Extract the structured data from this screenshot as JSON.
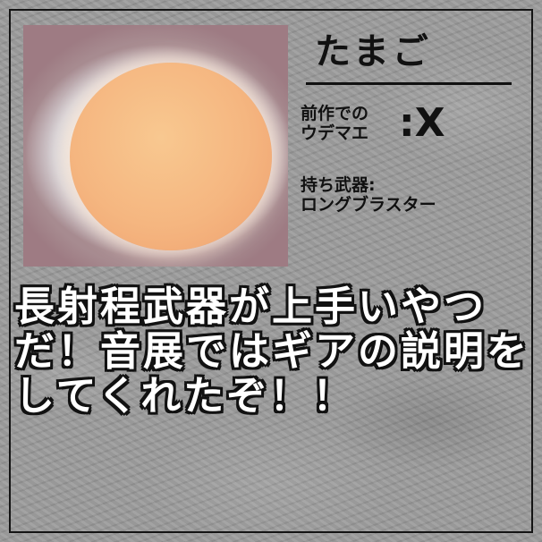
{
  "profile": {
    "name": "たまご",
    "rank_label_line1": "前作での",
    "rank_label_line2": "ウデマエ",
    "rank_value": "X",
    "weapon_label": "持ち武器:",
    "weapon_value": "ロングブラスター"
  },
  "comment": "長射程武器が上手いやつだ！音展ではギアの説明をしてくれたぞ！！",
  "colors": {
    "text": "#111111",
    "comment_text": "#ffffff",
    "background": "#9a9a9a"
  },
  "icons": {
    "photo": "fried-egg-photo"
  }
}
